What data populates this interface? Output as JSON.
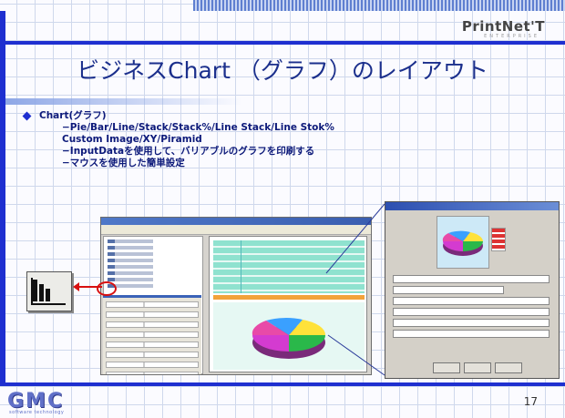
{
  "header": {
    "logo_text": "PrintNet'T",
    "logo_subtext": "ENTERPRISE"
  },
  "slide": {
    "title": "ビジネスChart （グラフ）のレイアウト",
    "page_number": "17"
  },
  "bullets": {
    "main": "Chart(グラフ)",
    "sub": [
      "−Pie/Bar/Line/Stack/Stack%/Line Stack/Line Stok%",
      "Custom Image/XY/Piramid",
      "−InputDataを使用して、バリアブルのグラフを印刷する",
      "−マウスを使用した簡単設定"
    ]
  },
  "footer": {
    "company_logo": "GMC",
    "company_sub": "software technology"
  },
  "colors": {
    "accent": "#1e2fd0",
    "title": "#1b2f8c",
    "highlight": "#d81010"
  },
  "icons": {
    "bar_chart": "bar-chart-icon",
    "bullet": "diamond-bullet-icon"
  }
}
